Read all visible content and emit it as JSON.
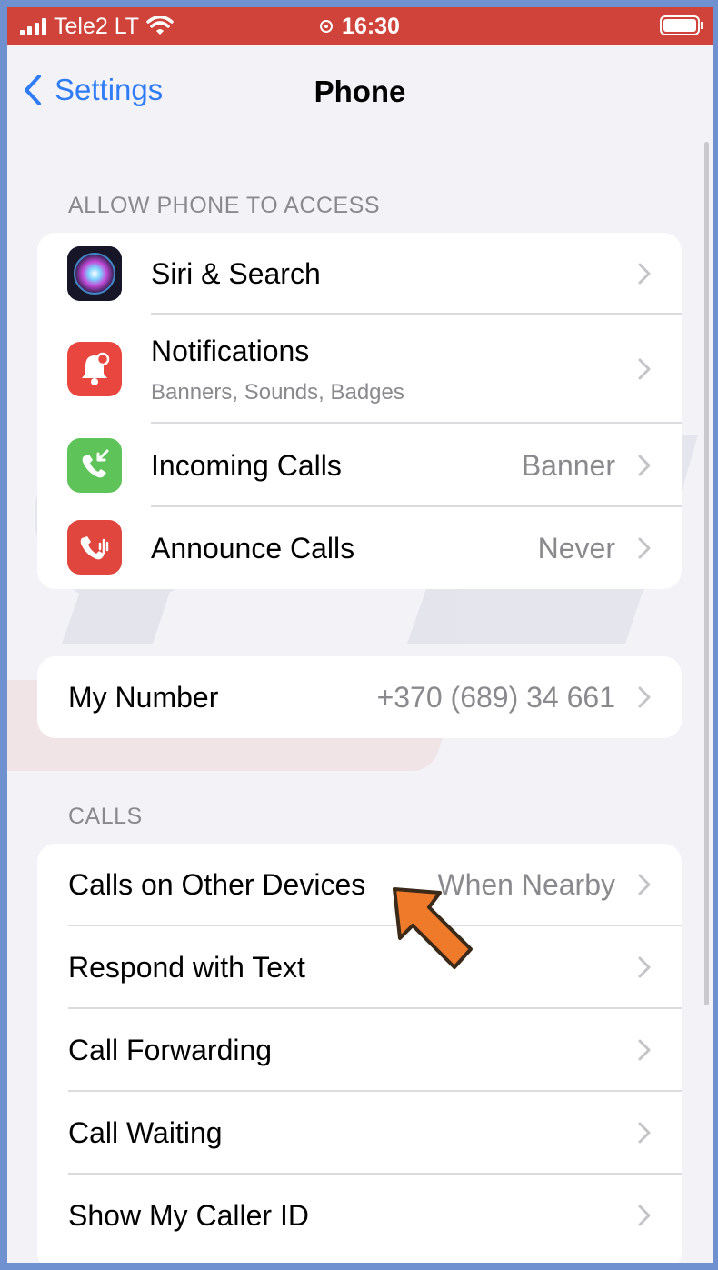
{
  "status_bar": {
    "carrier": "Tele2 LT",
    "time": "16:30",
    "bg_color": "#d0433a"
  },
  "nav": {
    "back_label": "Settings",
    "title": "Phone"
  },
  "sections": {
    "access_header": "ALLOW PHONE TO ACCESS",
    "calls_header": "CALLS"
  },
  "access_items": [
    {
      "icon": "siri-icon",
      "label": "Siri & Search",
      "value": ""
    },
    {
      "icon": "notifications-icon",
      "label": "Notifications",
      "sublabel": "Banners, Sounds, Badges",
      "value": ""
    },
    {
      "icon": "incoming-calls-icon",
      "label": "Incoming Calls",
      "value": "Banner"
    },
    {
      "icon": "announce-calls-icon",
      "label": "Announce Calls",
      "value": "Never"
    }
  ],
  "my_number": {
    "label": "My Number",
    "value": "+370 (689) 34 661"
  },
  "call_items": [
    {
      "label": "Calls on Other Devices",
      "value": "When Nearby"
    },
    {
      "label": "Respond with Text",
      "value": ""
    },
    {
      "label": "Call Forwarding",
      "value": ""
    },
    {
      "label": "Call Waiting",
      "value": ""
    },
    {
      "label": "Show My Caller ID",
      "value": ""
    }
  ],
  "colors": {
    "accent": "#2f7cf6",
    "notifications_icon": "#e9463f",
    "incoming_icon": "#5ec45a",
    "announce_icon": "#e0453e",
    "annotation_arrow": "#ef7b2a"
  }
}
